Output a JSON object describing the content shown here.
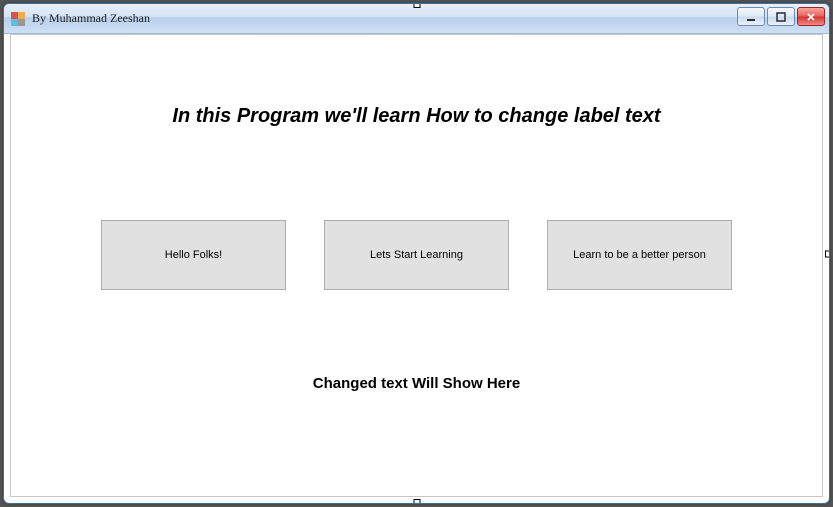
{
  "window": {
    "title": "By Muhammad Zeeshan"
  },
  "heading": "In this Program we'll learn How to change label text",
  "buttons": {
    "b1": "Hello Folks!",
    "b2": "Lets Start Learning",
    "b3": "Learn to be a better person"
  },
  "output_label": "Changed text Will Show Here"
}
